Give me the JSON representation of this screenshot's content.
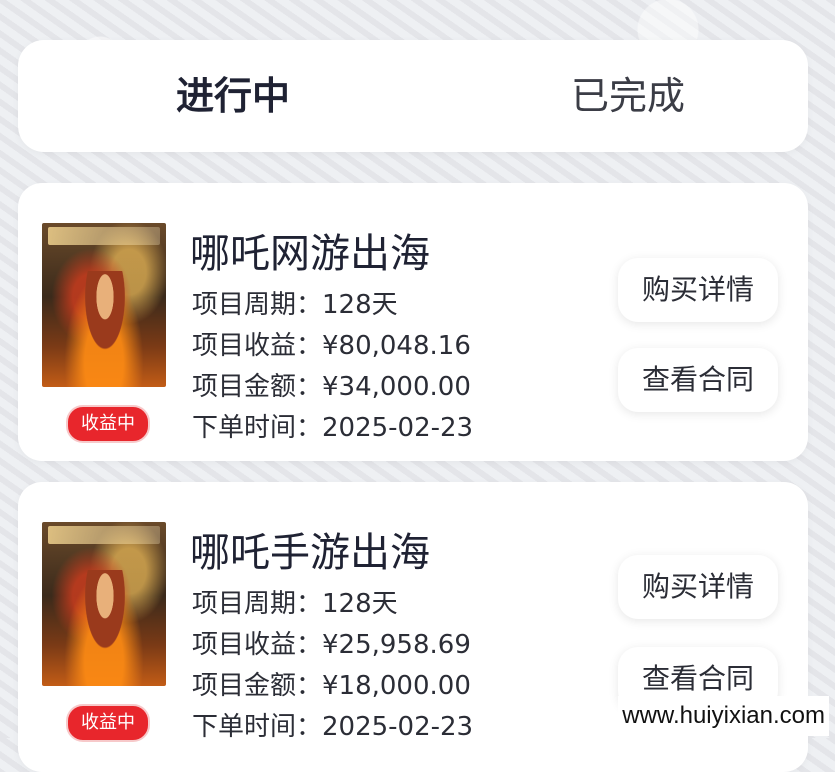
{
  "tabs": [
    {
      "label": "进行中",
      "active": true
    },
    {
      "label": "已完成",
      "active": false
    }
  ],
  "orders": [
    {
      "title": "哪吒网游出海",
      "status_badge": "收益中",
      "rows": [
        "项目周期：128天",
        "项目收益：¥80,048.16",
        "项目金额：¥34,000.00",
        "下单时间：2025-02-23"
      ],
      "buy_details_label": "购买详情",
      "view_contract_label": "查看合同"
    },
    {
      "title": "哪吒手游出海",
      "status_badge": "收益中",
      "rows": [
        "项目周期：128天",
        "项目收益：¥25,958.69",
        "项目金额：¥18,000.00",
        "下单时间：2025-02-23"
      ],
      "buy_details_label": "购买详情",
      "view_contract_label": "查看合同"
    }
  ],
  "watermark": "www.huiyixian.com",
  "colors": {
    "badge": "#e8262c",
    "active_tab_text": "#1f2233",
    "background": "#eceef1"
  }
}
